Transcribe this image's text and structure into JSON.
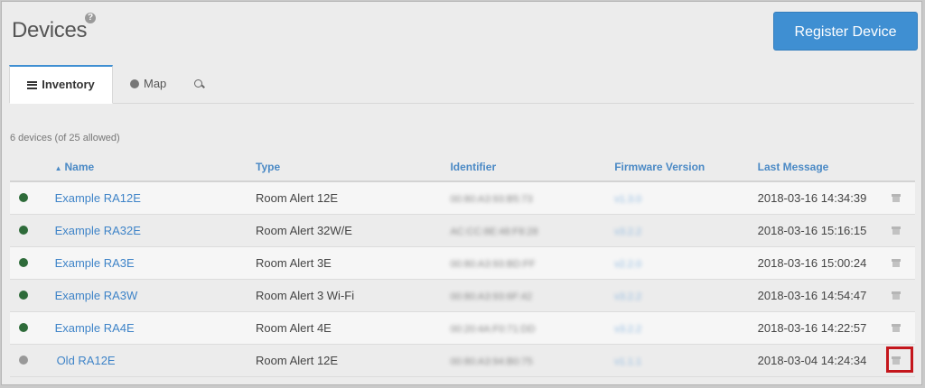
{
  "header": {
    "title": "Devices",
    "help_glyph": "?",
    "register_label": "Register Device"
  },
  "tabs": [
    {
      "label": "Inventory",
      "icon": "list-icon",
      "active": true
    },
    {
      "label": "Map",
      "icon": "globe-icon",
      "active": false
    },
    {
      "label": "",
      "icon": "search-icon",
      "active": false
    }
  ],
  "summary": "6 devices (of 25 allowed)",
  "table": {
    "columns": [
      "Name",
      "Type",
      "Identifier",
      "Firmware Version",
      "Last Message"
    ],
    "sort_arrow": "▲",
    "rows": [
      {
        "status": "online",
        "name": "Example RA12E",
        "type": "Room Alert 12E",
        "identifier": "00:80:A3:93:B5:73",
        "firmware": "v1.3.0",
        "last_message": "2018-03-16 14:34:39"
      },
      {
        "status": "online",
        "name": "Example RA32E",
        "type": "Room Alert 32W/E",
        "identifier": "AC:CC:8E:48:F8:28",
        "firmware": "v3.2.2",
        "last_message": "2018-03-16 15:16:15"
      },
      {
        "status": "online",
        "name": "Example RA3E",
        "type": "Room Alert 3E",
        "identifier": "00:80:A3:93:BD:FF",
        "firmware": "v2.2.0",
        "last_message": "2018-03-16 15:00:24"
      },
      {
        "status": "online",
        "name": "Example RA3W",
        "type": "Room Alert 3 Wi-Fi",
        "identifier": "00:80:A3:93:6F:42",
        "firmware": "v3.2.2",
        "last_message": "2018-03-16 14:54:47"
      },
      {
        "status": "online",
        "name": "Example RA4E",
        "type": "Room Alert 4E",
        "identifier": "00:20:4A:F0:71:DD",
        "firmware": "v3.2.2",
        "last_message": "2018-03-16 14:22:57"
      },
      {
        "status": "offline",
        "name": "Old RA12E",
        "type": "Room Alert 12E",
        "identifier": "00:80:A3:94:B0:75",
        "firmware": "v1.1.1",
        "last_message": "2018-03-04 14:24:34"
      }
    ]
  },
  "colors": {
    "accent": "#3f8fd2",
    "link": "#3f84c8",
    "online": "#2e6b3a",
    "offline": "#999999",
    "highlight": "#c4161c"
  }
}
